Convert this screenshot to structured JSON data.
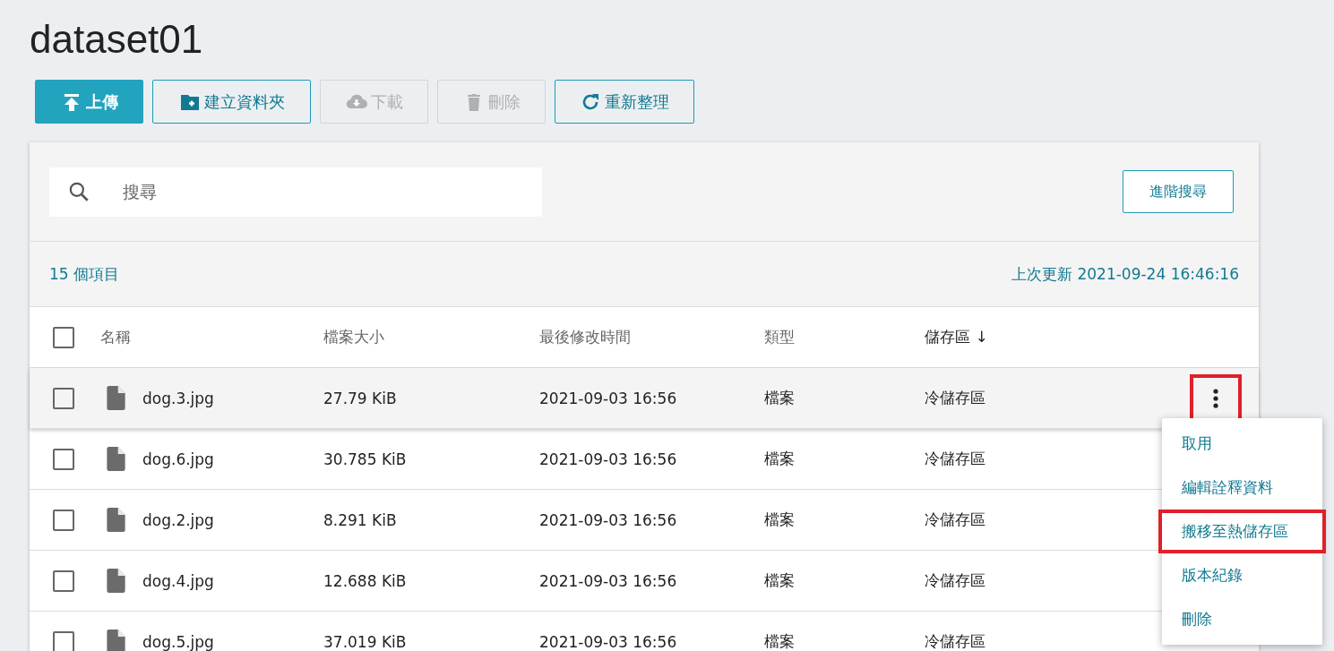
{
  "title": "dataset01",
  "toolbar": [
    {
      "label": "上傳",
      "kind": "upload",
      "primary": true,
      "disabled": false
    },
    {
      "label": "建立資料夾",
      "kind": "folder",
      "primary": false,
      "disabled": false
    },
    {
      "label": "下載",
      "kind": "download",
      "primary": false,
      "disabled": true
    },
    {
      "label": "刪除",
      "kind": "trash",
      "primary": false,
      "disabled": true
    },
    {
      "label": "重新整理",
      "kind": "refresh",
      "primary": false,
      "disabled": false
    }
  ],
  "search": {
    "placeholder": "搜尋",
    "advanced_button": "進階搜尋"
  },
  "item_count": "15 個項目",
  "last_updated": "上次更新 2021-09-24 16:46:16",
  "table": {
    "select_all_checked": false,
    "more_button_highlighted": true,
    "columns": [
      "名稱",
      "檔案大小",
      "最後修改時間",
      "類型",
      "儲存區 ↓"
    ],
    "rows": [
      {
        "name": "dog.3.jpg",
        "size": "27.79 KiB",
        "modified": "2021-09-03 16:56",
        "type": "檔案",
        "storage": "冷儲存區",
        "checked": false,
        "hovered": true
      },
      {
        "name": "dog.6.jpg",
        "size": "30.785 KiB",
        "modified": "2021-09-03 16:56",
        "type": "檔案",
        "storage": "冷儲存區",
        "checked": false,
        "hovered": false
      },
      {
        "name": "dog.2.jpg",
        "size": "8.291 KiB",
        "modified": "2021-09-03 16:56",
        "type": "檔案",
        "storage": "冷儲存區",
        "checked": false,
        "hovered": false
      },
      {
        "name": "dog.4.jpg",
        "size": "12.688 KiB",
        "modified": "2021-09-03 16:56",
        "type": "檔案",
        "storage": "冷儲存區",
        "checked": false,
        "hovered": false
      },
      {
        "name": "dog.5.jpg",
        "size": "37.019 KiB",
        "modified": "2021-09-03 16:56",
        "type": "檔案",
        "storage": "冷儲存區",
        "checked": false,
        "hovered": false
      }
    ]
  },
  "context_menu": [
    {
      "label": "取用",
      "highlighted": false
    },
    {
      "label": "編輯詮釋資料",
      "highlighted": false
    },
    {
      "label": "搬移至熱儲存區",
      "highlighted": true
    },
    {
      "label": "版本紀錄",
      "highlighted": false
    },
    {
      "label": "刪除",
      "highlighted": false
    }
  ]
}
